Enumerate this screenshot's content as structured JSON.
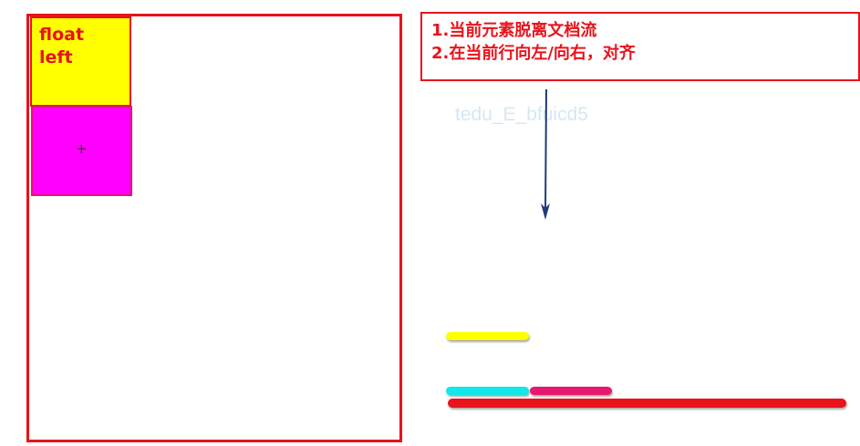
{
  "float_block": {
    "label": "float\nleft"
  },
  "cursor_symbol": "+",
  "notes": {
    "line1": "1.当前元素脱离文档流",
    "line2": "2.在当前行向左/向右，对齐"
  },
  "watermark": "tedu_E_bfuicd5",
  "colors": {
    "border_red": "#e8131b",
    "float_yellow": "#ffff00",
    "block_magenta": "#ff00ff",
    "bar_cyan": "#11e8e8",
    "bar_pink": "#e8186e",
    "arrow_navy": "#1f3a78"
  }
}
